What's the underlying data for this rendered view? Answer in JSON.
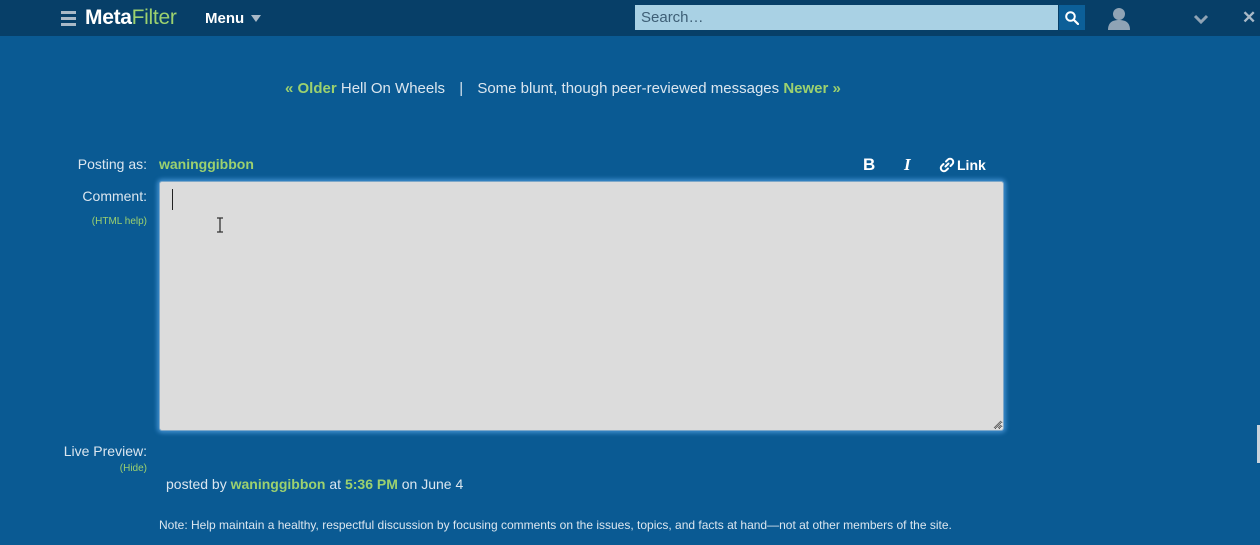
{
  "header": {
    "logo_meta": "Meta",
    "logo_filter": "Filter",
    "menu_label": "Menu",
    "search_placeholder": "Search…"
  },
  "post_nav": {
    "older_label": "« Older",
    "older_title": "Hell On Wheels",
    "separator": "|",
    "newer_title": "Some blunt, though peer-reviewed messages",
    "newer_label": "Newer »"
  },
  "comment_form": {
    "posting_as_label": "Posting as:",
    "username": "waninggibbon",
    "comment_label": "Comment:",
    "html_help": "(HTML help)",
    "bold_label": "B",
    "italic_label": "I",
    "link_label": "Link",
    "comment_value": ""
  },
  "preview": {
    "live_preview_label": "Live Preview:",
    "hide_label": "(Hide)",
    "posted_by_prefix": "posted by",
    "posted_by_user": "waninggibbon",
    "at_text": "at",
    "time": "5:36 PM",
    "on_date": "on June 4"
  },
  "note": "Note: Help maintain a healthy, respectful discussion by focusing comments on the issues, topics, and facts at hand—not at other members of the site."
}
